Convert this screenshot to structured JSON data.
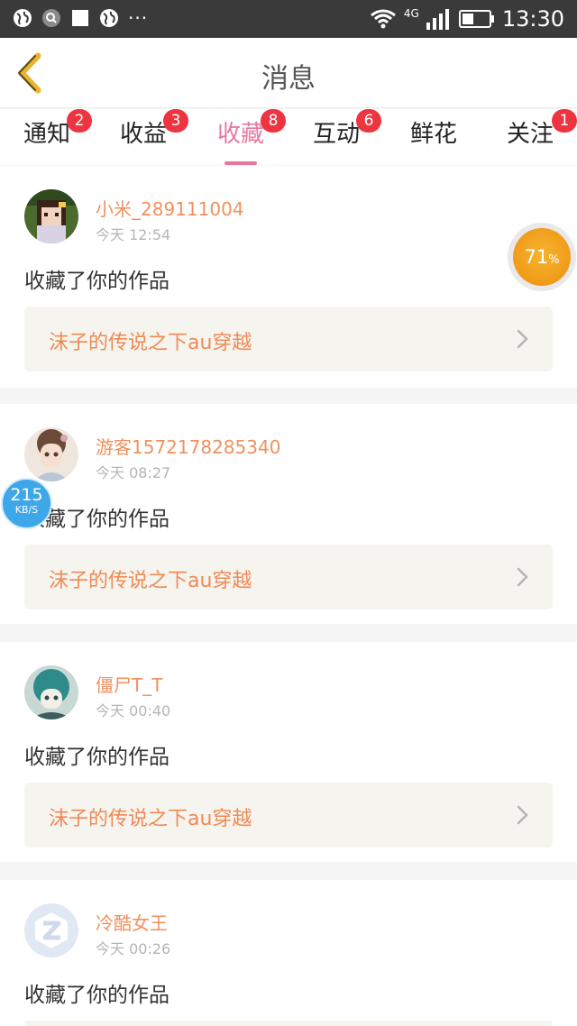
{
  "status_bar": {
    "time": "13:30",
    "network": "4G",
    "more": "···"
  },
  "header": {
    "title": "消息"
  },
  "tabs": [
    {
      "label": "通知",
      "badge": "2"
    },
    {
      "label": "收益",
      "badge": "3"
    },
    {
      "label": "收藏",
      "badge": "8",
      "active": true
    },
    {
      "label": "互动",
      "badge": "6"
    },
    {
      "label": "鲜花",
      "badge": ""
    },
    {
      "label": "关注",
      "badge": "1"
    }
  ],
  "messages": [
    {
      "user": "小米_289111004",
      "time": "今天 12:54",
      "action": "收藏了你的作品",
      "work": "沫子的传说之下au穿越"
    },
    {
      "user": "游客1572178285340",
      "time": "今天 08:27",
      "action": "收藏了你的作品",
      "work": "沫子的传说之下au穿越"
    },
    {
      "user": "僵尸T_T",
      "time": "今天 00:40",
      "action": "收藏了你的作品",
      "work": "沫子的传说之下au穿越"
    },
    {
      "user": "冷酷女王",
      "time": "今天 00:26",
      "action": "收藏了你的作品",
      "work": ""
    }
  ],
  "speed_widget": {
    "value": "215",
    "unit": "KB/S"
  },
  "percent_widget": {
    "value": "71",
    "sign": "%"
  },
  "colors": {
    "accent": "#e8779f",
    "badge": "#ec3540",
    "username": "#f0915e",
    "work_title": "#f08a55"
  }
}
